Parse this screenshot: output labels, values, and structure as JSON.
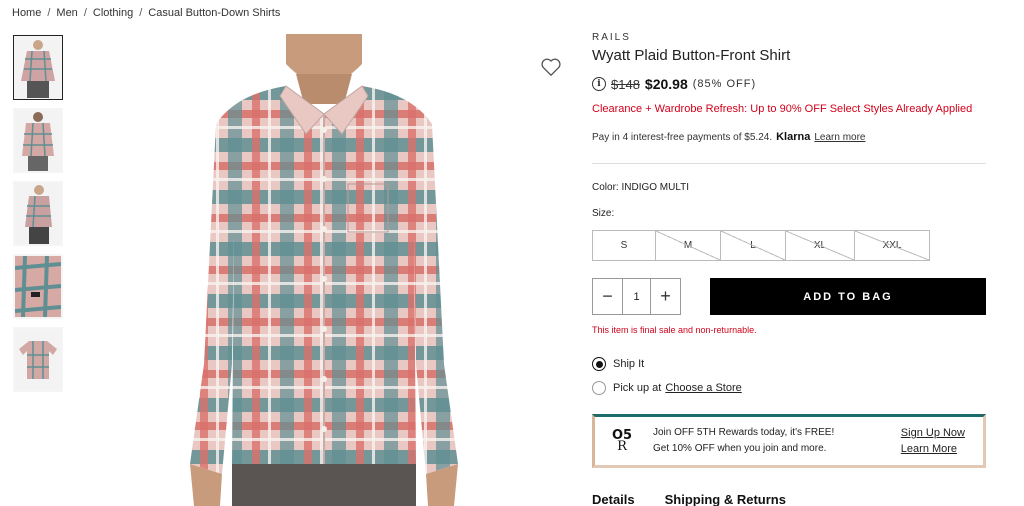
{
  "breadcrumb": {
    "items": [
      "Home",
      "Men",
      "Clothing",
      "Casual Button-Down Shirts"
    ],
    "separator": "/"
  },
  "product": {
    "brand": "RAILS",
    "title": "Wyatt Plaid Button-Front Shirt",
    "info_icon": "i",
    "original_price": "$148",
    "sale_price": "$20.98",
    "discount": "(85% OFF)",
    "promo": "Clearance + Wardrobe Refresh: Up to 90% OFF Select Styles Already Applied",
    "klarna": {
      "text": "Pay in 4 interest-free payments of $5.24.",
      "logo": "Klarna",
      "learn_more": "Learn more"
    },
    "color_label": "Color:",
    "color_value": "INDIGO MULTI",
    "size_label": "Size:",
    "sizes": [
      {
        "label": "S",
        "available": true
      },
      {
        "label": "M",
        "available": false
      },
      {
        "label": "L",
        "available": false
      },
      {
        "label": "XL",
        "available": false
      },
      {
        "label": "XXL",
        "available": false
      }
    ],
    "quantity": "1",
    "qty_minus": "−",
    "qty_plus": "+",
    "add_to_bag": "ADD TO BAG",
    "final_sale": "This item is final sale and non-returnable.",
    "fulfillment": {
      "ship": "Ship It",
      "pickup_prefix": "Pick up at",
      "pickup_link": "Choose a Store"
    }
  },
  "rewards": {
    "logo_top": "O5",
    "logo_bottom": "R",
    "line1": "Join OFF 5TH Rewards today, it's FREE!",
    "line2": "Get 10% OFF when you join and more.",
    "sign_up": "Sign Up Now",
    "learn_more": "Learn More"
  },
  "tabs": [
    "Details",
    "Shipping & Returns"
  ],
  "colors": {
    "promo_red": "#d0021b",
    "button_black": "#000000",
    "plaid_red": "#d9706a",
    "plaid_teal": "#5f8f93"
  },
  "icons": {
    "wishlist": "heart-icon",
    "info": "info-icon"
  }
}
